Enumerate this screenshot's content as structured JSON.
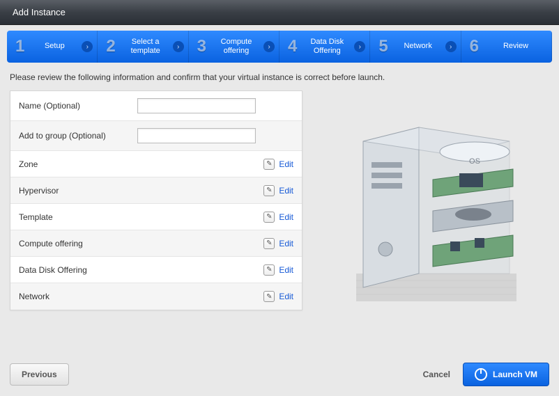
{
  "header": {
    "title": "Add Instance"
  },
  "wizard": [
    {
      "num": "1",
      "label": "Setup"
    },
    {
      "num": "2",
      "label": "Select a template"
    },
    {
      "num": "3",
      "label": "Compute offering"
    },
    {
      "num": "4",
      "label": "Data Disk Offering"
    },
    {
      "num": "5",
      "label": "Network"
    },
    {
      "num": "6",
      "label": "Review"
    }
  ],
  "intro": "Please review the following information and confirm that your virtual instance is correct before launch.",
  "rows": {
    "name_label": "Name (Optional)",
    "name_value": "",
    "group_label": "Add to group (Optional)",
    "group_value": "",
    "zone_label": "Zone",
    "hypervisor_label": "Hypervisor",
    "template_label": "Template",
    "compute_label": "Compute offering",
    "datadisk_label": "Data Disk Offering",
    "network_label": "Network",
    "edit": "Edit"
  },
  "illustration": {
    "os_badge": "OS"
  },
  "footer": {
    "previous": "Previous",
    "cancel": "Cancel",
    "launch": "Launch VM"
  }
}
